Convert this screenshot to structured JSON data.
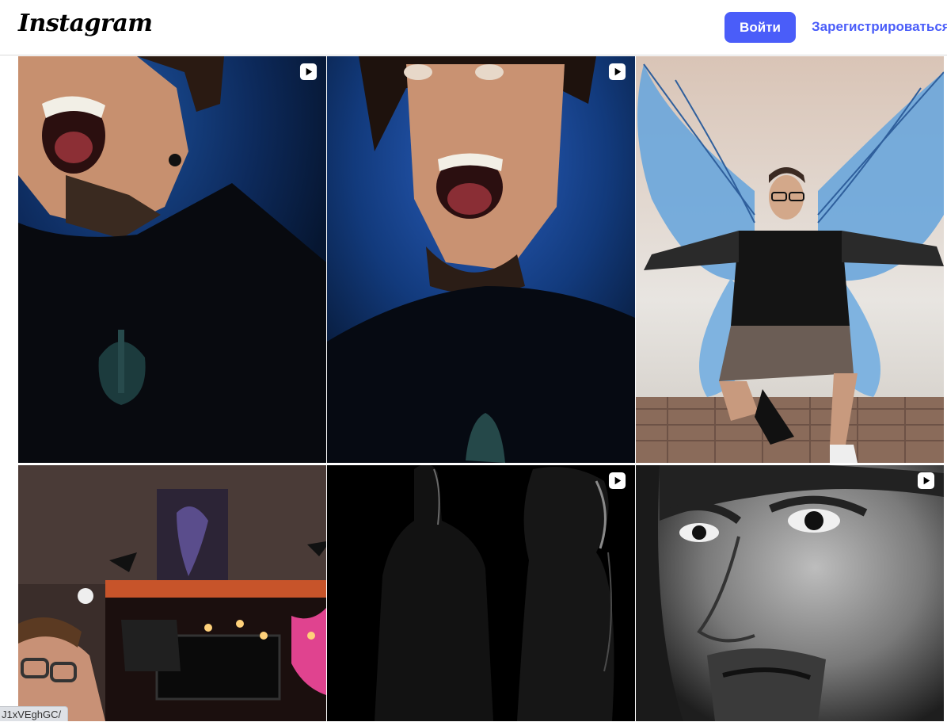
{
  "header": {
    "logo": "Instagram",
    "login_label": "Войти",
    "signup_label": "Зарегистрироваться"
  },
  "posts": [
    {
      "kind": "reel",
      "subject": "man shouting, blue background"
    },
    {
      "kind": "reel",
      "subject": "man shouting looking up, blue background"
    },
    {
      "kind": "photo",
      "subject": "man squatting in front of butterfly wings mural"
    },
    {
      "kind": "photo",
      "subject": "man at desk with halloween decorations"
    },
    {
      "kind": "reel",
      "subject": "silhouettes in dark, black and white"
    },
    {
      "kind": "reel",
      "subject": "black and white close-up face"
    }
  ],
  "status_bar": {
    "url_text": "J1xVEghGC/"
  },
  "colors": {
    "accent": "#4a5df9",
    "border": "#dbdbdb"
  },
  "icons": {
    "reel": "reel-play-icon"
  }
}
